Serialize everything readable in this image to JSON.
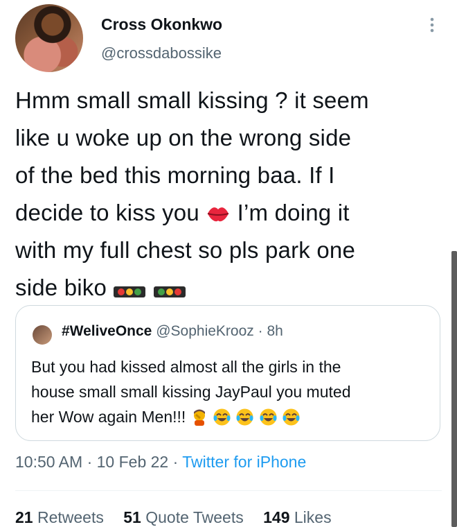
{
  "author": {
    "name": "Cross Okonkwo",
    "handle": "@crossdabossike"
  },
  "tweet": {
    "line1": "Hmm small small kissing ? it seem",
    "line2": "like u woke up on the wrong side",
    "line3": "of the bed this morning baa. If I",
    "line4_before": "decide to kiss you ",
    "line4_after": " I’m doing it",
    "line5": "with my full chest so pls park one",
    "line6": "side biko "
  },
  "quoted": {
    "name": "#WeliveOnce",
    "handle": "@SophieKrooz",
    "separator": " · ",
    "time": "8h",
    "line1": "But you had kissed almost all the girls in the",
    "line2": "house small small kissing JayPaul you muted",
    "line3": "her Wow again Men!!!"
  },
  "meta": {
    "time": "10:50 AM",
    "separator": " · ",
    "date": "10 Feb 22",
    "source": "Twitter for iPhone"
  },
  "stats": {
    "retweets_count": "21",
    "retweets_label": " Retweets",
    "quotes_count": "51",
    "quotes_label": " Quote Tweets",
    "likes_count": "149",
    "likes_label": " Likes"
  },
  "icons": {
    "more": "more-vertical-icon",
    "kiss": "kiss-mark-emoji",
    "traffic_light": "traffic-light-emoji",
    "facepalm": "facepalm-emoji",
    "laugh": "tears-of-joy-emoji"
  },
  "colors": {
    "link": "#1d9bf0",
    "secondary_text": "#536471",
    "border": "#cfd9de"
  }
}
